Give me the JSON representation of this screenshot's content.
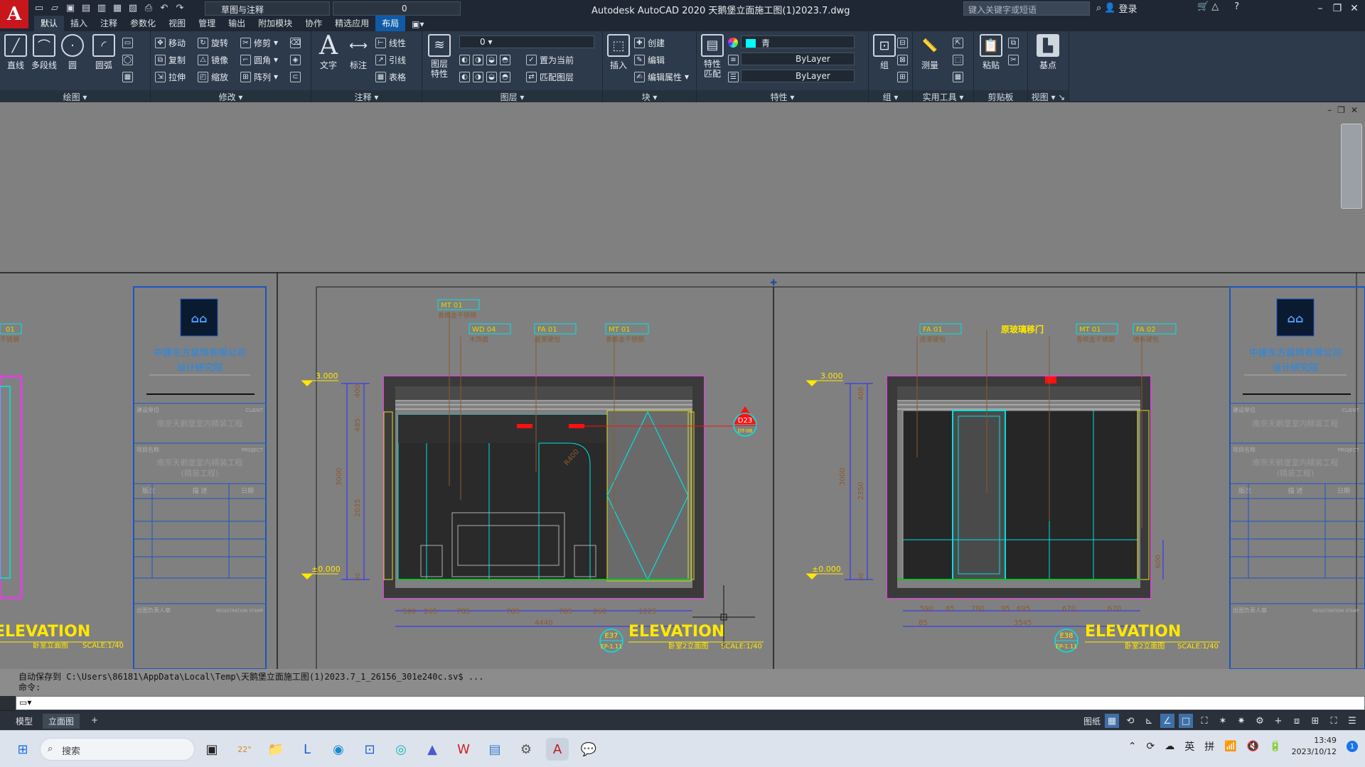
{
  "titlebar": {
    "logo": "A",
    "workspace": "草图与注释",
    "layer_value": "0",
    "title": "Autodesk AutoCAD 2020    天鹅堡立面施工图(1)2023.7.dwg",
    "search_placeholder": "键入关键字或短语",
    "login": "登录"
  },
  "tabs": [
    "默认",
    "插入",
    "注释",
    "参数化",
    "视图",
    "管理",
    "输出",
    "附加模块",
    "协作",
    "精选应用",
    "布局"
  ],
  "ribbon": {
    "draw": {
      "title": "绘图",
      "tools": [
        "直线",
        "多段线",
        "圆",
        "圆弧"
      ]
    },
    "modify": {
      "title": "修改",
      "tools": [
        "移动",
        "旋转",
        "修剪",
        "复制",
        "镜像",
        "圆角",
        "拉伸",
        "缩放",
        "阵列"
      ]
    },
    "annotation": {
      "title": "注释",
      "tools": [
        "文字",
        "标注",
        "线性",
        "引线",
        "表格"
      ]
    },
    "layers": {
      "title": "图层",
      "big": "图层\n特性",
      "tools": [
        "置为当前",
        "匹配图层"
      ],
      "layer_value": "0"
    },
    "block": {
      "title": "块",
      "big": "插入",
      "tools": [
        "创建",
        "编辑",
        "编辑属性"
      ]
    },
    "properties": {
      "title": "特性",
      "big": "特性\n匹配",
      "color": "青",
      "linetype": "ByLayer",
      "lineweight": "ByLayer"
    },
    "groups": {
      "title": "组",
      "big": "组"
    },
    "utilities": {
      "title": "实用工具",
      "big": "测量"
    },
    "clipboard": {
      "title": "剪贴板",
      "big": "粘贴"
    },
    "view": {
      "title": "视图",
      "big": "基点"
    }
  },
  "drawing": {
    "company": "中建东方装饰有限公司",
    "institute": "设计研究院",
    "client_label": "建设单位",
    "client_en": "CLIENT",
    "client_name": "南京天鹅堡室内精装工程",
    "project_label": "项目名称",
    "project_en": "PROJECT",
    "project_name": "南京天鹅堡室内精装工程",
    "project_sub": "(精装工程)",
    "rev_cols": [
      "版次",
      "描 述",
      "日期"
    ],
    "stamp_label": "出图负责人章",
    "stamp_en": "REGISTRATION STAMP",
    "elev1": {
      "title": "ELEVATION",
      "ref": "E37",
      "sheet": "EP-1.11",
      "caption": "卧室2立面图",
      "scale": "SCALE:1/40",
      "total": "4440",
      "dims": [
        "590",
        "265",
        "785",
        "785",
        "785",
        "260",
        "1225"
      ],
      "h3000": "3000",
      "h2035": "2035",
      "h485": "485",
      "h400": "400",
      "h80": "80",
      "r": "R400",
      "tags": [
        "MT 01",
        "WD 04",
        "FA 01",
        "MT 01"
      ],
      "notes": [
        "香槟金不锈钢",
        "木饰面",
        "皮革硬包",
        "香槟金不锈钢"
      ],
      "level_top": "3.000",
      "level_bottom": "±0.000",
      "callout": "D23",
      "callout_sub": "DT-08"
    },
    "elev2": {
      "title": "ELEVATION",
      "ref": "E38",
      "sheet": "EP-1.11",
      "caption": "卧室2立面图",
      "scale": "SCALE:1/40",
      "total": "3545",
      "dims": [
        "590",
        "85",
        "780",
        "95",
        "695",
        "670",
        "670"
      ],
      "h3000": "3000",
      "h2350": "2350",
      "h400": "400",
      "h600": "600",
      "h80": "80",
      "tags": [
        "FA 01",
        "MT 01",
        "FA 02"
      ],
      "notes": [
        "皮革硬包",
        "香槟金不锈钢",
        "墙布硬包"
      ],
      "red_note": "原玻璃移门",
      "level_top": "3.000",
      "level_bottom": "±0.000",
      "dim_85": "85"
    },
    "left_caption": "卧室立面图",
    "left_scale": "SCALE:1/40",
    "left_tag": "01",
    "left_note": "不锈钢"
  },
  "command": {
    "history": "自动保存到 C:\\Users\\86181\\AppData\\Local\\Temp\\天鹅堡立面施工图(1)2023.7_1_26156_301e240c.sv$ ...",
    "prompt": "命令:",
    "input": ""
  },
  "status": {
    "tabs": [
      "模型",
      "立面图"
    ],
    "paper": "图纸"
  },
  "taskbar": {
    "search": "搜索",
    "weather": "22°",
    "ime1": "英",
    "ime2": "拼",
    "time": "13:49",
    "date": "2023/10/12",
    "notif": "1"
  }
}
